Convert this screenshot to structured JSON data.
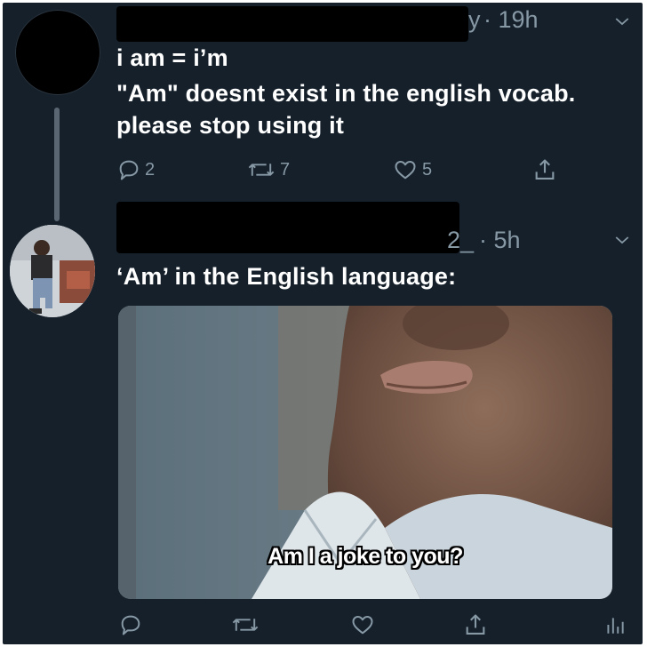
{
  "tweet1": {
    "handle_fragment": "y",
    "time": "· 19h",
    "lines": [
      "i am = i’m",
      "\"Am\" doesnt exist in the english vocab.",
      "please stop using it"
    ],
    "replies": "2",
    "retweets": "7",
    "likes": "5"
  },
  "tweet2": {
    "handle_fragment": "2_",
    "time": "· 5h",
    "text": "‘Am’ in the English language:",
    "media_caption": "Am I a joke to you?"
  },
  "colors": {
    "background": "#15202b",
    "text": "#ffffff",
    "secondary": "#8899a6"
  },
  "icons": [
    "reply-icon",
    "retweet-icon",
    "like-icon",
    "share-icon",
    "analytics-icon",
    "chevron-down-icon"
  ]
}
